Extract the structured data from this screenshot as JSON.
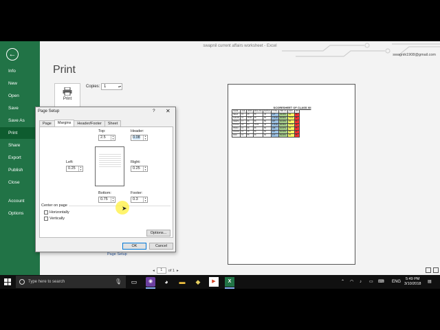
{
  "window_title": "swapnil current affairs worksheet - Excel",
  "account": "swagnik1908@gmail.com",
  "backstage": {
    "back_icon": "back-arrow-icon",
    "items": [
      "Info",
      "New",
      "Open",
      "Save",
      "Save As",
      "Print",
      "Share",
      "Export",
      "Publish",
      "Close",
      "Account",
      "Options"
    ],
    "active": "Print"
  },
  "print_pane": {
    "title": "Print",
    "print_button_label": "Print",
    "copies_label": "Copies:",
    "copies_value": "1",
    "page_setup_link": "Page Setup",
    "page_current": "1",
    "page_of": "of 1"
  },
  "dialog": {
    "title": "Page Setup",
    "help": "?",
    "close": "✕",
    "tabs": [
      "Page",
      "Margins",
      "Header/Footer",
      "Sheet"
    ],
    "active_tab": "Margins",
    "top_label": "Top:",
    "top_value": "2.5",
    "header_label": "Header:",
    "header_value": "0.08",
    "left_label": "Left:",
    "left_value": "0.25",
    "right_label": "Right:",
    "right_value": "0.25",
    "bottom_label": "Bottom:",
    "bottom_value": "0.75",
    "footer_label": "Footer:",
    "footer_value": "0.3",
    "center_label": "Center on page",
    "horizontally_label": "Horizontally",
    "vertically_label": "Vertically",
    "options_button": "Options...",
    "ok_button": "OK",
    "cancel_button": "Cancel"
  },
  "preview": {
    "sheet_title": "SCORESHEET OF CLASS XII",
    "headers": [
      "NAME",
      "AGE",
      "HINDI",
      "ENGLISH",
      "MATHS",
      "TOTAL",
      "PER (%)",
      "MAX",
      "MIN"
    ],
    "rows": [
      [
        "NEHA",
        "16",
        "45",
        "56",
        "46",
        "147",
        "49.00%",
        "56",
        "45"
      ],
      [
        "SHILPA",
        "16",
        "75.66",
        "45",
        "56",
        "176.66",
        "58.89%",
        "75.66",
        "45"
      ],
      [
        "DEEPA",
        "17",
        "66",
        "66",
        "56",
        "187",
        "62.33%",
        "66",
        "56"
      ],
      [
        "POOJA",
        "18",
        "54",
        "75.66",
        "46",
        "175.66",
        "58.55%",
        "75.66",
        "46"
      ],
      [
        "PINKU",
        "16",
        "66",
        "66",
        "56",
        "188",
        "62.67%",
        "66",
        "56"
      ],
      [
        "PAWAN",
        "16",
        "45",
        "56",
        "56",
        "157",
        "52.33%",
        "56",
        "45"
      ],
      [
        "RAVI",
        "16",
        "55",
        "66",
        "56",
        "177",
        "59.00%",
        "66",
        "55"
      ]
    ],
    "colors": {
      "per_col": "#a8d08d",
      "max_col": "#ffff66",
      "min_col": "#ff3333",
      "total_col": "#9dc3e6"
    }
  },
  "taskbar": {
    "search_placeholder": "Type here to search",
    "language": "ENG",
    "time": "5:49 PM",
    "date": "3/10/2018"
  }
}
